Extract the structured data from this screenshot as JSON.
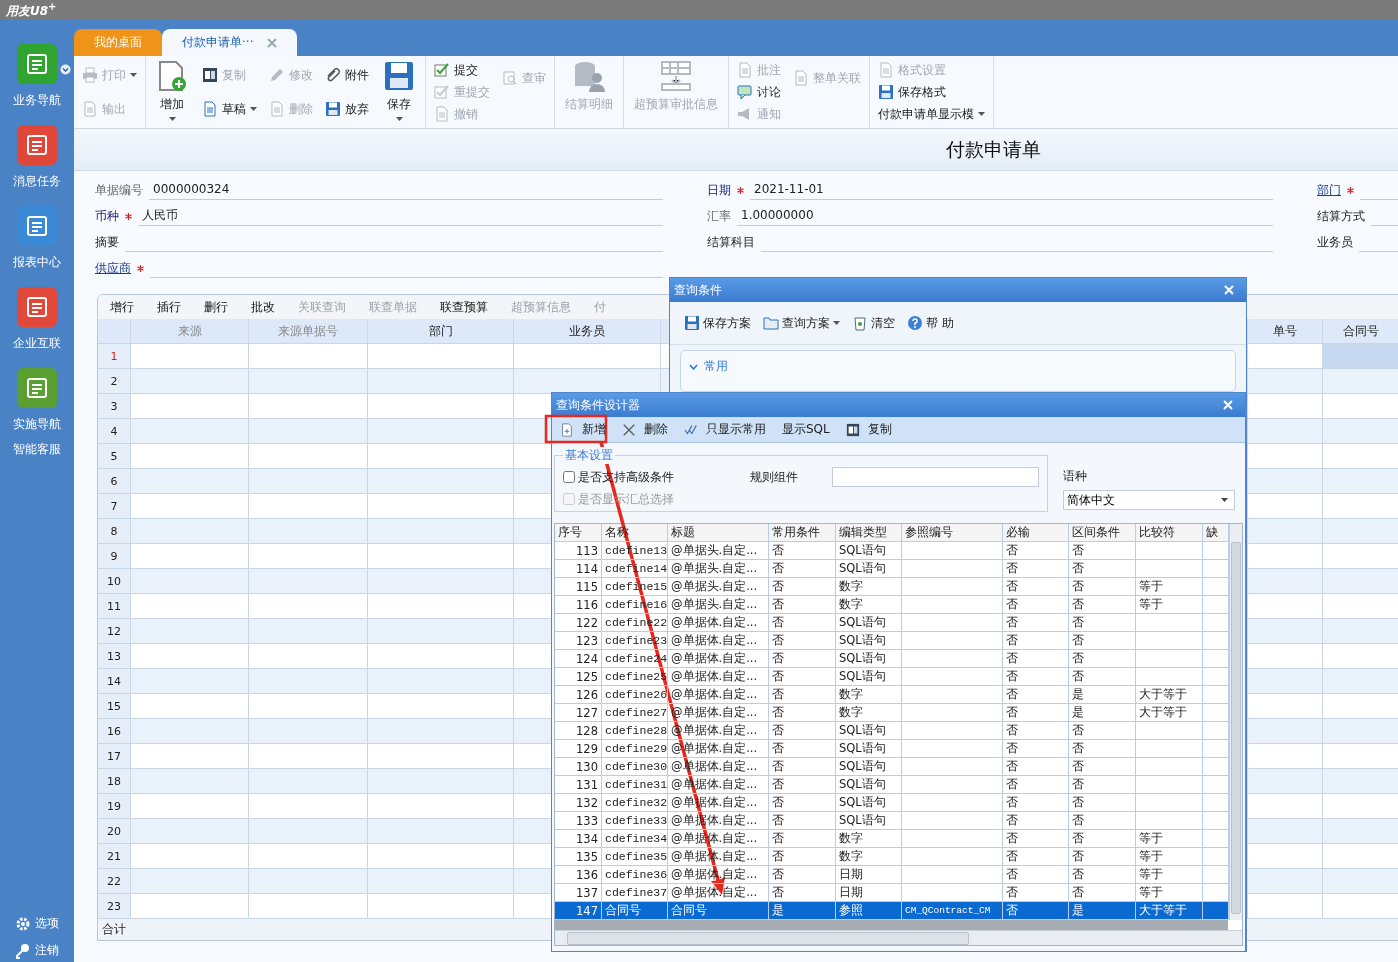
{
  "app": {
    "logo": "用友U8$^{+}$"
  },
  "sidebar": {
    "items": [
      {
        "label": "业务导航",
        "color": "#2fa52f",
        "dropdown": true
      },
      {
        "label": "消息任务",
        "color": "#e0463a",
        "dropdown": false
      },
      {
        "label": "报表中心",
        "color": "#3b8ad8",
        "dropdown": false
      },
      {
        "label": "企业互联",
        "color": "#e2483a",
        "dropdown": false
      },
      {
        "label": "实施导航",
        "color": "#5aa030",
        "dropdown": false
      },
      {
        "label": "智能客服"
      }
    ],
    "bottom": [
      {
        "label": "选项",
        "kind": "gear"
      },
      {
        "label": "注销",
        "kind": "key"
      }
    ]
  },
  "tabs": [
    {
      "label": "我的桌面",
      "kind": "home",
      "selected": false,
      "closable": false
    },
    {
      "label": "付款申请单···",
      "kind": "doc",
      "selected": true,
      "closable": true
    }
  ],
  "toolbar": [
    {
      "columns": [
        {
          "kind": "stack",
          "buttons": [
            {
              "kind": "print",
              "label": "打印",
              "disabled": true,
              "dropdown": true
            },
            {
              "kind": "export",
              "label": "输出",
              "disabled": true,
              "dropdown": false
            }
          ]
        }
      ]
    },
    {
      "columns": [
        {
          "kind": "big",
          "button": {
            "kind": "add",
            "label": "增加",
            "disabled": false,
            "dropdown": true
          }
        },
        {
          "kind": "stack",
          "buttons": [
            {
              "kind": "copy",
              "label": "复制",
              "disabled": true,
              "dropdown": false
            },
            {
              "kind": "draft",
              "label": "草稿",
              "disabled": false,
              "dropdown": true
            }
          ]
        },
        {
          "kind": "stack",
          "buttons": [
            {
              "kind": "edit",
              "label": "修改",
              "disabled": true,
              "dropdown": false
            },
            {
              "kind": "delete",
              "label": "删除",
              "disabled": true,
              "dropdown": false
            }
          ]
        },
        {
          "kind": "stack",
          "buttons": [
            {
              "kind": "attach",
              "label": "附件",
              "disabled": false,
              "dropdown": false
            },
            {
              "kind": "discard",
              "label": "放弃",
              "disabled": false,
              "dropdown": false
            }
          ]
        },
        {
          "kind": "big",
          "button": {
            "kind": "save",
            "label": "保存",
            "disabled": false,
            "dropdown": true
          }
        }
      ]
    },
    {
      "columns": [
        {
          "kind": "stack",
          "buttons": [
            {
              "kind": "submit",
              "label": "提交",
              "disabled": false,
              "dropdown": false
            },
            {
              "kind": "resubmit",
              "label": "重提交",
              "disabled": true,
              "dropdown": false
            },
            {
              "kind": "revoke",
              "label": "撤销",
              "disabled": true,
              "dropdown": false
            }
          ]
        },
        {
          "kind": "stack",
          "buttons": [
            {
              "kind": "audit",
              "label": "查审",
              "disabled": true,
              "dropdown": false
            }
          ]
        }
      ]
    },
    {
      "columns": [
        {
          "kind": "big",
          "button": {
            "kind": "detail",
            "label": "结算明细",
            "disabled": true,
            "dropdown": false
          }
        }
      ]
    },
    {
      "columns": [
        {
          "kind": "big",
          "button": {
            "kind": "budget",
            "label": "超预算审批信息",
            "disabled": true,
            "dropdown": false
          }
        }
      ]
    },
    {
      "columns": [
        {
          "kind": "stack",
          "buttons": [
            {
              "kind": "note",
              "label": "批注",
              "disabled": true,
              "dropdown": false
            },
            {
              "kind": "discuss",
              "label": "讨论",
              "disabled": false,
              "dropdown": false
            },
            {
              "kind": "notify",
              "label": "通知",
              "disabled": true,
              "dropdown": false
            }
          ]
        },
        {
          "kind": "stack",
          "buttons": [
            {
              "kind": "link",
              "label": "整单关联",
              "disabled": true,
              "dropdown": false
            }
          ]
        }
      ]
    },
    {
      "columns": [
        {
          "kind": "stack",
          "buttons": [
            {
              "kind": "format",
              "label": "格式设置",
              "disabled": true,
              "dropdown": false
            },
            {
              "kind": "saveformat",
              "label": "保存格式",
              "disabled": false,
              "dropdown": false
            },
            {
              "kind": "template",
              "label": "付款申请单显示模",
              "disabled": false,
              "dropdown": true
            }
          ]
        }
      ]
    }
  ],
  "form": {
    "title": "付款申请单",
    "columns": [
      {
        "fields": [
          {
            "label": "单据编号",
            "kind": "muted",
            "required": false,
            "value": "0000000324"
          },
          {
            "label": "币种",
            "kind": "ref",
            "required": true,
            "value": "人民币"
          },
          {
            "label": "摘要",
            "kind": "plain",
            "required": false
          },
          {
            "label": "供应商",
            "kind": "link",
            "required": true
          }
        ]
      },
      {
        "fields": [
          {
            "label": "日期",
            "kind": "ref",
            "required": true,
            "value": "2021-11-01"
          },
          {
            "label": "汇率",
            "kind": "muted",
            "required": false,
            "value": "1.00000000"
          },
          {
            "label": "结算科目",
            "kind": "plain",
            "required": false
          }
        ]
      },
      {
        "fields": [
          {
            "label": "部门",
            "kind": "link",
            "required": true
          },
          {
            "label": "结算方式",
            "kind": "plain",
            "required": false
          },
          {
            "label": "业务员",
            "kind": "plain",
            "required": false
          }
        ]
      }
    ]
  },
  "grid": {
    "actions": [
      {
        "label": "增行",
        "disabled": false
      },
      {
        "label": "插行",
        "disabled": false
      },
      {
        "label": "删行",
        "disabled": false
      },
      {
        "label": "批改",
        "disabled": false
      },
      {
        "label": "关联查询",
        "disabled": true
      },
      {
        "label": "联查单据",
        "disabled": true
      },
      {
        "label": "联查预算",
        "disabled": false
      },
      {
        "label": "超预算信息",
        "disabled": true
      },
      {
        "label": "付",
        "disabled": true
      }
    ],
    "columns": [
      {
        "label": "来源",
        "disabled": true
      },
      {
        "label": "来源单据号",
        "disabled": true
      },
      {
        "label": "部门",
        "disabled": false
      },
      {
        "label": "业务员",
        "disabled": false
      },
      {
        "label": "单号",
        "disabled": false
      },
      {
        "label": "合同号",
        "disabled": false
      }
    ],
    "rows": [
      {
        "number": "1",
        "selected": true
      },
      {
        "number": "2",
        "selected": false
      },
      {
        "number": "3",
        "selected": false
      },
      {
        "number": "4",
        "selected": false
      },
      {
        "number": "5",
        "selected": false
      },
      {
        "number": "6",
        "selected": false
      },
      {
        "number": "7",
        "selected": false
      },
      {
        "number": "8",
        "selected": false
      },
      {
        "number": "9",
        "selected": false
      },
      {
        "number": "10",
        "selected": false
      },
      {
        "number": "11",
        "selected": false
      },
      {
        "number": "12",
        "selected": false
      },
      {
        "number": "13",
        "selected": false
      },
      {
        "number": "14",
        "selected": false
      },
      {
        "number": "15",
        "selected": false
      },
      {
        "number": "16",
        "selected": false
      },
      {
        "number": "17",
        "selected": false
      },
      {
        "number": "18",
        "selected": false
      },
      {
        "number": "19",
        "selected": false
      },
      {
        "number": "20",
        "selected": false
      },
      {
        "number": "21",
        "selected": false
      },
      {
        "number": "22",
        "selected": false
      },
      {
        "number": "23",
        "selected": false
      }
    ],
    "footer": "合计"
  },
  "query_dialog": {
    "title": "查询条件",
    "tools": [
      {
        "kind": "save",
        "label": "保存方案",
        "dropdown": false
      },
      {
        "kind": "open",
        "label": "查询方案",
        "dropdown": true
      },
      {
        "kind": "clear",
        "label": "清空",
        "dropdown": false
      },
      {
        "kind": "help",
        "label": "帮 助",
        "dropdown": false
      }
    ],
    "section": {
      "label": "常用",
      "expanded": true
    }
  },
  "designer_dialog": {
    "title": "查询条件设计器",
    "tools": [
      {
        "kind": "new",
        "label": "新增"
      },
      {
        "kind": "remove",
        "label": "删除"
      },
      {
        "kind": "filter",
        "label": "只显示常用"
      },
      {
        "kind": "text",
        "label": "显示SQL"
      },
      {
        "kind": "copy",
        "label": "复制"
      }
    ],
    "settings": {
      "legend": "基本设置",
      "options": [
        {
          "label": "是否支持高级条件",
          "checked": false,
          "disabled": false
        },
        {
          "label": "是否显示汇总选择",
          "checked": false,
          "disabled": true
        }
      ],
      "rule_label": "规则组件",
      "language_label": "语种",
      "language": "简体中文"
    },
    "columns": [
      "序号",
      "名称",
      "标题",
      "常用条件",
      "编辑类型",
      "参照编号",
      "必输",
      "区间条件",
      "比较符",
      "缺"
    ],
    "rows": [
      {
        "no": "113",
        "name": "cdefine13",
        "title": "@单据头.自定...",
        "common": "否",
        "edit_type": "SQL语句",
        "required": "否",
        "range": "否",
        "selected": false
      },
      {
        "no": "114",
        "name": "cdefine14",
        "title": "@单据头.自定...",
        "common": "否",
        "edit_type": "SQL语句",
        "required": "否",
        "range": "否",
        "selected": false
      },
      {
        "no": "115",
        "name": "cdefine15",
        "title": "@单据头.自定...",
        "common": "否",
        "edit_type": "数字",
        "required": "否",
        "range": "否",
        "compare": "等于",
        "selected": false
      },
      {
        "no": "116",
        "name": "cdefine16",
        "title": "@单据头.自定...",
        "common": "否",
        "edit_type": "数字",
        "required": "否",
        "range": "否",
        "compare": "等于",
        "selected": false
      },
      {
        "no": "122",
        "name": "cdefine22",
        "title": "@单据体.自定...",
        "common": "否",
        "edit_type": "SQL语句",
        "required": "否",
        "range": "否",
        "selected": false
      },
      {
        "no": "123",
        "name": "cdefine23",
        "title": "@单据体.自定...",
        "common": "否",
        "edit_type": "SQL语句",
        "required": "否",
        "range": "否",
        "selected": false
      },
      {
        "no": "124",
        "name": "cdefine24",
        "title": "@单据体.自定...",
        "common": "否",
        "edit_type": "SQL语句",
        "required": "否",
        "range": "否",
        "selected": false
      },
      {
        "no": "125",
        "name": "cdefine25",
        "title": "@单据体.自定...",
        "common": "否",
        "edit_type": "SQL语句",
        "required": "否",
        "range": "否",
        "selected": false
      },
      {
        "no": "126",
        "name": "cdefine26",
        "title": "@单据体.自定...",
        "common": "否",
        "edit_type": "数字",
        "required": "否",
        "range": "是",
        "compare": "大于等于",
        "selected": false
      },
      {
        "no": "127",
        "name": "cdefine27",
        "title": "@单据体.自定...",
        "common": "否",
        "edit_type": "数字",
        "required": "否",
        "range": "是",
        "compare": "大于等于",
        "selected": false
      },
      {
        "no": "128",
        "name": "cdefine28",
        "title": "@单据体.自定...",
        "common": "否",
        "edit_type": "SQL语句",
        "required": "否",
        "range": "否",
        "selected": false
      },
      {
        "no": "129",
        "name": "cdefine29",
        "title": "@单据体.自定...",
        "common": "否",
        "edit_type": "SQL语句",
        "required": "否",
        "range": "否",
        "selected": false
      },
      {
        "no": "130",
        "name": "cdefine30",
        "title": "@单据体.自定...",
        "common": "否",
        "edit_type": "SQL语句",
        "required": "否",
        "range": "否",
        "selected": false
      },
      {
        "no": "131",
        "name": "cdefine31",
        "title": "@单据体.自定...",
        "common": "否",
        "edit_type": "SQL语句",
        "required": "否",
        "range": "否",
        "selected": false
      },
      {
        "no": "132",
        "name": "cdefine32",
        "title": "@单据体.自定...",
        "common": "否",
        "edit_type": "SQL语句",
        "required": "否",
        "range": "否",
        "selected": false
      },
      {
        "no": "133",
        "name": "cdefine33",
        "title": "@单据体.自定...",
        "common": "否",
        "edit_type": "SQL语句",
        "required": "否",
        "range": "否",
        "selected": false
      },
      {
        "no": "134",
        "name": "cdefine34",
        "title": "@单据体.自定...",
        "common": "否",
        "edit_type": "数字",
        "required": "否",
        "range": "否",
        "compare": "等于",
        "selected": false
      },
      {
        "no": "135",
        "name": "cdefine35",
        "title": "@单据体.自定...",
        "common": "否",
        "edit_type": "数字",
        "required": "否",
        "range": "否",
        "compare": "等于",
        "selected": false
      },
      {
        "no": "136",
        "name": "cdefine36",
        "title": "@单据体.自定...",
        "common": "否",
        "edit_type": "日期",
        "required": "否",
        "range": "否",
        "compare": "等于",
        "selected": false
      },
      {
        "no": "137",
        "name": "cdefine37",
        "title": "@单据体.自定...",
        "common": "否",
        "edit_type": "日期",
        "required": "否",
        "range": "否",
        "compare": "等于",
        "selected": false
      },
      {
        "no": "147",
        "name": "合同号",
        "title": "合同号",
        "common": "是",
        "edit_type": "参照",
        "ref": "CM_QContract_CM",
        "required": "否",
        "range": "是",
        "compare": "大于等于",
        "selected": true
      }
    ]
  }
}
